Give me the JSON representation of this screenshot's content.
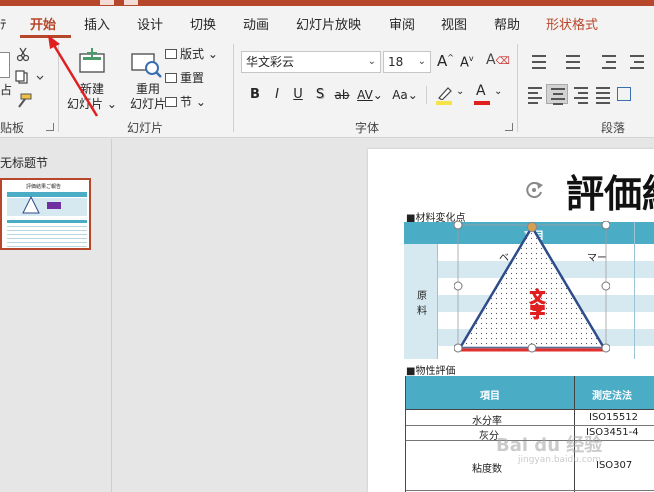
{
  "tabs": {
    "file": "ﾃ",
    "home": "开始",
    "insert": "插入",
    "design": "设计",
    "transitions": "切换",
    "animations": "动画",
    "slideshow": "幻灯片放映",
    "review": "审阅",
    "view": "视图",
    "help": "帮助",
    "shape_format": "形状格式"
  },
  "clipboard": {
    "paste_label": "占",
    "group_label": "贴板"
  },
  "slides_group": {
    "new_slide_line1": "新建",
    "new_slide_line2": "幻灯片",
    "reuse_line1": "重用",
    "reuse_line2": "幻灯片",
    "layout": "版式",
    "reset": "重置",
    "section": "节",
    "group_label": "幻灯片"
  },
  "font_group": {
    "font_name": "华文彩云",
    "font_size": "18",
    "bold": "B",
    "italic": "I",
    "underline": "U",
    "shadow": "S",
    "strike": "ab",
    "spacing": "AV",
    "case": "Aa",
    "group_label": "字体",
    "highlight_color": "#f7e24a",
    "font_color": "#e02020"
  },
  "paragraph_group": {
    "group_label": "段落"
  },
  "left_pane": {
    "section_title": "无标题节",
    "thumb_title": "評価結果ご報告"
  },
  "slide": {
    "title": "評価結",
    "material_label": "■材料変化点",
    "header_item": "項目",
    "base_text": "ベ",
    "mar_text": "マー",
    "genryo": "原",
    "genryo2": "料",
    "property_label": "■物性評価",
    "prop_header_item": "項目",
    "prop_header_method": "測定法法",
    "rows": [
      {
        "item": "水分率",
        "method": "ISO15512"
      },
      {
        "item": "灰分",
        "method": "ISO3451-4"
      },
      {
        "item": "粘度数",
        "method": "ISO307"
      }
    ],
    "shape_text": "文字",
    "watermark": "Bai du 经验",
    "watermark2": "jingyan.baidu.com"
  },
  "colors": {
    "accent": "#b7472a",
    "table_header": "#4bacc6",
    "table_light": "#d6e9f0",
    "triangle_edge": "#2e4b8a"
  }
}
